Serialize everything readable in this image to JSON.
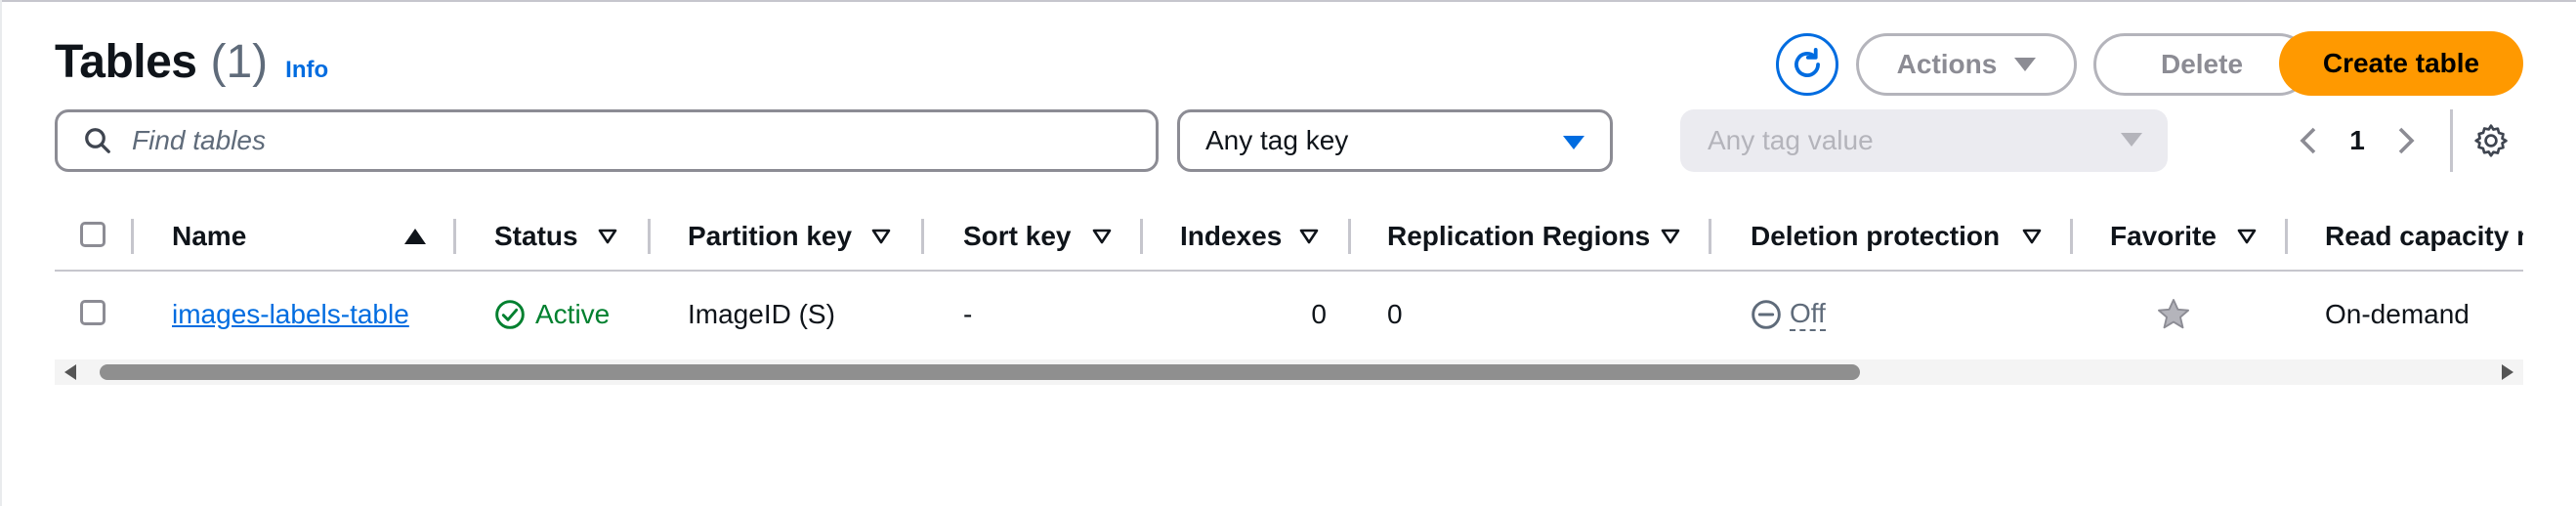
{
  "header": {
    "title": "Tables",
    "count": "(1)",
    "info_link": "Info"
  },
  "toolbar": {
    "refresh_icon": "refresh-icon",
    "actions_label": "Actions",
    "delete_label": "Delete",
    "create_label": "Create table"
  },
  "filters": {
    "search_placeholder": "Find tables",
    "tag_key_value": "Any tag key",
    "tag_value_placeholder": "Any tag value"
  },
  "pagination": {
    "current_page": "1"
  },
  "table": {
    "columns": [
      "Name",
      "Status",
      "Partition key",
      "Sort key",
      "Indexes",
      "Replication Regions",
      "Deletion protection",
      "Favorite",
      "Read capacity mode"
    ],
    "rows": [
      {
        "name": "images-labels-table",
        "status": "Active",
        "partition_key": "ImageID (S)",
        "sort_key": "-",
        "indexes": "0",
        "replication_regions": "0",
        "deletion_protection": "Off",
        "favorite": false,
        "read_capacity_mode": "On-demand"
      }
    ]
  },
  "colors": {
    "primary_orange": "#ff9900",
    "link_blue": "#006ce0",
    "success_green": "#00802f",
    "border_gray": "#8c8c94",
    "disabled_gray": "#b4b4bb"
  }
}
